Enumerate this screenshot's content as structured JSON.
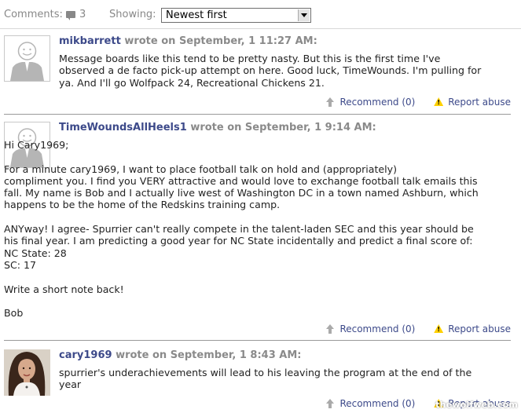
{
  "toolbar": {
    "comments_label": "Comments:",
    "comment_count": "3",
    "showing_label": "Showing:",
    "sort_selected": "Newest first"
  },
  "comments": [
    {
      "username": "mikbarrett",
      "meta": "wrote on September, 1 11:27 AM:",
      "body": "Message boards like this tend to be pretty nasty. But this is the first time I've\nobserved a de facto pick-up attempt on here. Good luck, TimeWounds. I'm pulling for\nya. And I'll go Wolfpack 24, Recreational Chickens 21.",
      "recommend": "Recommend (0)",
      "report": "Report abuse",
      "avatar": "default-avatar-icon"
    },
    {
      "username": "TimeWoundsAllHeels1",
      "meta": "wrote on September, 1 9:14 AM:",
      "body": "Hi Cary1969;\n\nFor a minute cary1969, I want to place football talk on hold and (appropriately)\ncompliment you. I find you VERY attractive and would love to exchange football talk emails this\nfall. My name is Bob and I actually live west of Washington DC in a town named Ashburn, which\nhappens to be the home of the Redskins training camp.\n\nANYway! I agree- Spurrier can't really compete in the talent-laden SEC and this year should be\nhis final year. I am predicting a good year for NC State incidentally and predict a final score of:\nNC State: 28\nSC: 17\n\nWrite a short note back!\n\nBob",
      "recommend": "Recommend (0)",
      "report": "Report abuse",
      "avatar": "default-avatar-icon"
    },
    {
      "username": "cary1969",
      "meta": "wrote on September, 1 8:43 AM:",
      "body": "spurrier's underachievements will lead to his leaving the program at the end of the\nyear",
      "recommend": "Recommend (0)",
      "report": "Report abuse",
      "avatar": "user-photo"
    }
  ],
  "watermark": "thewolfweb.com",
  "colors": {
    "username": "#3d4a8a",
    "meta": "#8a8a8a",
    "link": "#3d4a8a",
    "warning": "#ffd000"
  }
}
